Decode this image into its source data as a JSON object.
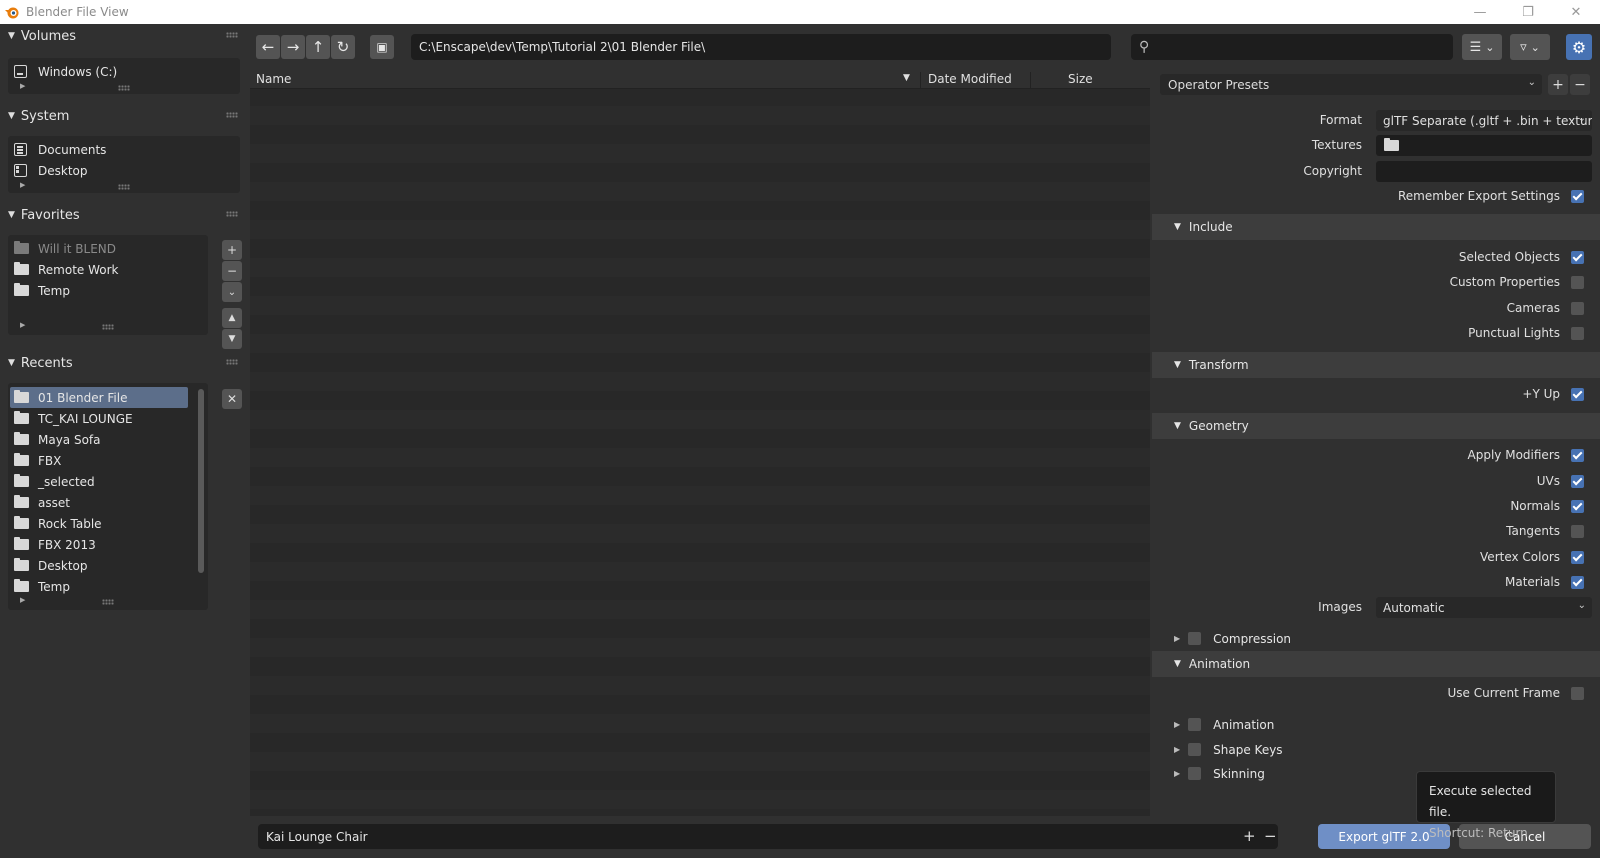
{
  "window": {
    "title": "Blender File View"
  },
  "sidebar": {
    "volumes": {
      "title": "Volumes",
      "items": [
        {
          "label": "Windows (C:)",
          "icon": "drive-icon"
        }
      ]
    },
    "system": {
      "title": "System",
      "items": [
        {
          "label": "Documents",
          "icon": "documents-icon"
        },
        {
          "label": "Desktop",
          "icon": "desktop-icon"
        }
      ]
    },
    "favorites": {
      "title": "Favorites",
      "items": [
        {
          "label": "Will it BLEND",
          "dim": true
        },
        {
          "label": "Remote Work"
        },
        {
          "label": "Temp"
        }
      ]
    },
    "recents": {
      "title": "Recents",
      "items": [
        {
          "label": "01 Blender File",
          "selected": true
        },
        {
          "label": "TC_KAI LOUNGE"
        },
        {
          "label": "Maya Sofa"
        },
        {
          "label": "FBX"
        },
        {
          "label": "_selected"
        },
        {
          "label": "asset"
        },
        {
          "label": "Rock Table"
        },
        {
          "label": "FBX 2013"
        },
        {
          "label": "Desktop"
        },
        {
          "label": "Temp"
        }
      ]
    }
  },
  "toolbar": {
    "path": "C:\\Enscape\\dev\\Temp\\Tutorial 2\\01 Blender File\\",
    "search_placeholder": ""
  },
  "filelist": {
    "columns": {
      "name": "Name",
      "date": "Date Modified",
      "size": "Size"
    }
  },
  "props": {
    "presets_label": "Operator Presets",
    "format_label": "Format",
    "format_value": "glTF Separate (.gltf + .bin + textur...",
    "textures_label": "Textures",
    "textures_value": "",
    "copyright_label": "Copyright",
    "copyright_value": "",
    "remember_label": "Remember Export Settings",
    "include": {
      "title": "Include",
      "selected_objects": "Selected Objects",
      "custom_properties": "Custom Properties",
      "cameras": "Cameras",
      "punctual_lights": "Punctual Lights"
    },
    "transform": {
      "title": "Transform",
      "y_up": "+Y Up"
    },
    "geometry": {
      "title": "Geometry",
      "apply_modifiers": "Apply Modifiers",
      "uvs": "UVs",
      "normals": "Normals",
      "tangents": "Tangents",
      "vertex_colors": "Vertex Colors",
      "materials": "Materials",
      "images_label": "Images",
      "images_value": "Automatic",
      "compression": "Compression"
    },
    "animation": {
      "title": "Animation",
      "use_current_frame": "Use Current Frame",
      "animation": "Animation",
      "shape_keys": "Shape Keys",
      "skinning": "Skinning"
    },
    "checked": {
      "remember": true,
      "selected_objects": true,
      "custom_properties": false,
      "cameras": false,
      "punctual_lights": false,
      "y_up": true,
      "apply_modifiers": true,
      "uvs": true,
      "normals": true,
      "tangents": false,
      "vertex_colors": true,
      "materials": true,
      "use_current_frame": false
    }
  },
  "bottom": {
    "filename": "Kai Lounge Chair",
    "export_label": "Export glTF 2.0",
    "cancel_label": "Cancel"
  },
  "tooltip": {
    "line1": "Execute selected file.",
    "line2": "Shortcut: Return"
  },
  "colors": {
    "accent": "#4772b3",
    "export": "#6f8fc6",
    "background": "#303030"
  }
}
